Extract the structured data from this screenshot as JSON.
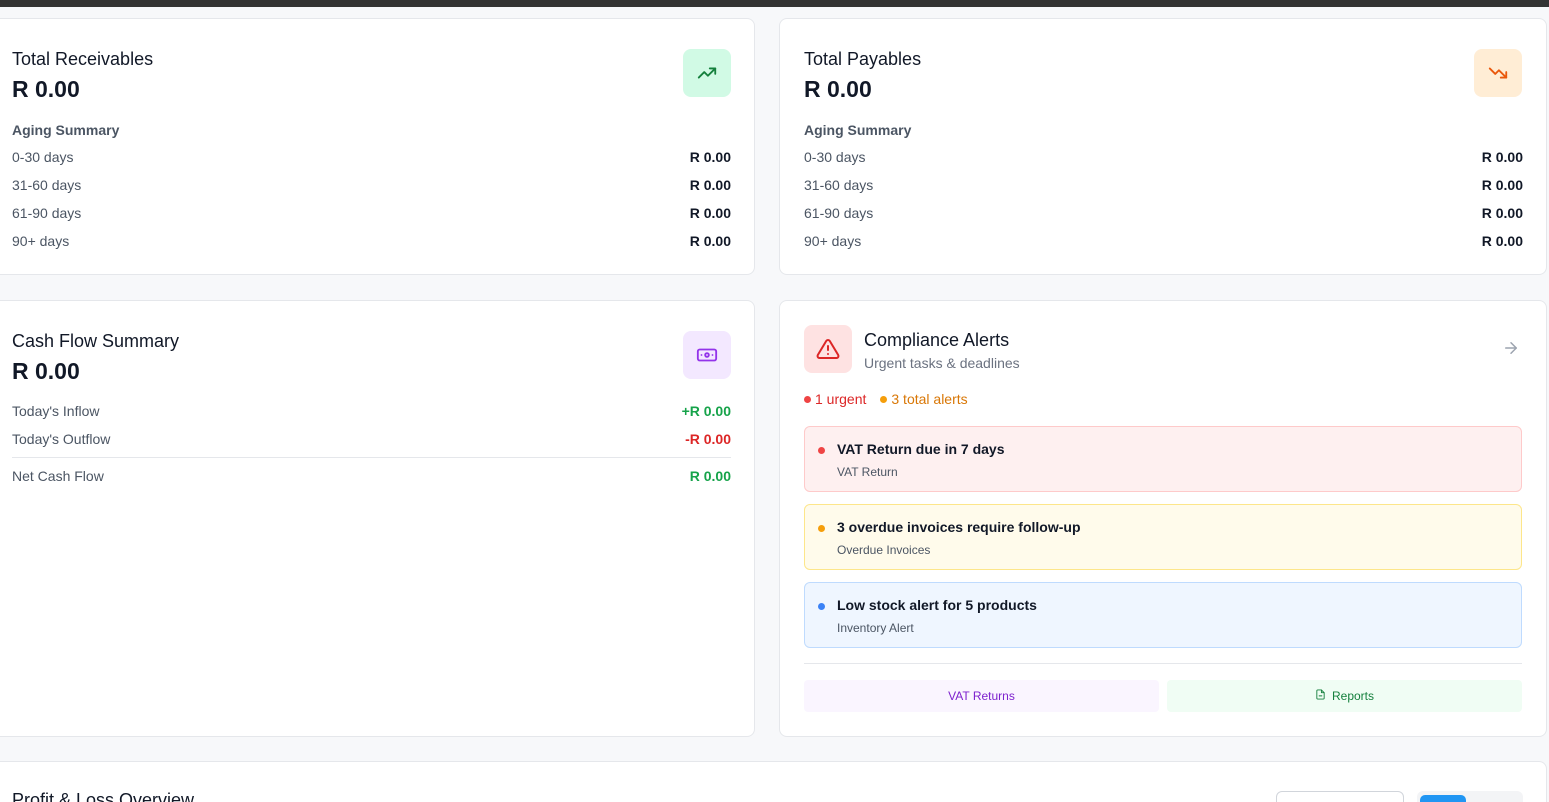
{
  "receivables": {
    "title": "Total Receivables",
    "amount": "R 0.00",
    "icon": "trending-up-icon",
    "aging_label": "Aging Summary",
    "rows": [
      {
        "label": "0-30 days",
        "value": "R 0.00"
      },
      {
        "label": "31-60 days",
        "value": "R 0.00"
      },
      {
        "label": "61-90 days",
        "value": "R 0.00"
      },
      {
        "label": "90+ days",
        "value": "R 0.00"
      }
    ]
  },
  "payables": {
    "title": "Total Payables",
    "amount": "R 0.00",
    "icon": "trending-down-icon",
    "aging_label": "Aging Summary",
    "rows": [
      {
        "label": "0-30 days",
        "value": "R 0.00"
      },
      {
        "label": "31-60 days",
        "value": "R 0.00"
      },
      {
        "label": "61-90 days",
        "value": "R 0.00"
      },
      {
        "label": "90+ days",
        "value": "R 0.00"
      }
    ]
  },
  "cashflow": {
    "title": "Cash Flow Summary",
    "amount": "R 0.00",
    "icon": "banknote-icon",
    "inflow_label": "Today's Inflow",
    "inflow_value": "+R 0.00",
    "outflow_label": "Today's Outflow",
    "outflow_value": "-R 0.00",
    "net_label": "Net Cash Flow",
    "net_value": "R 0.00"
  },
  "compliance": {
    "title": "Compliance Alerts",
    "subtitle": "Urgent tasks & deadlines",
    "icon": "alert-triangle-icon",
    "urgent_count": "1 urgent",
    "total_count": "3 total alerts",
    "alerts": [
      {
        "title": "VAT Return due in 7 days",
        "category": "VAT Return",
        "color": "#ef4444"
      },
      {
        "title": "3 overdue invoices require follow-up",
        "category": "Overdue Invoices",
        "color": "#f59e0b"
      },
      {
        "title": "Low stock alert for 5 products",
        "category": "Inventory Alert",
        "color": "#3b82f6"
      }
    ],
    "vat_button": "VAT Returns",
    "reports_button": "Reports"
  },
  "profit_loss": {
    "title": "Profit & Loss Overview"
  },
  "colors": {
    "green": "#16a34a",
    "red": "#dc2626",
    "amber": "#d97706",
    "blue_accent": "#2196f3"
  }
}
